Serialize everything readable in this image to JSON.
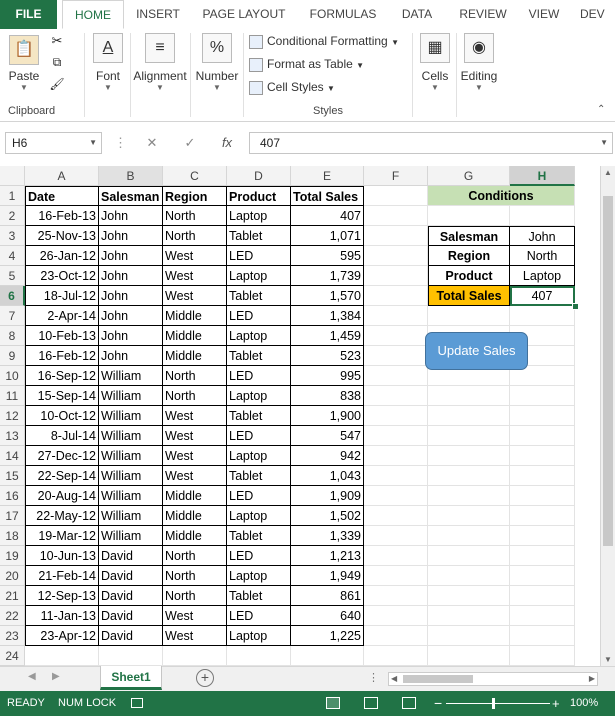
{
  "tabs": [
    "FILE",
    "HOME",
    "INSERT",
    "PAGE LAYOUT",
    "FORMULAS",
    "DATA",
    "REVIEW",
    "VIEW",
    "DEV"
  ],
  "ribbon": {
    "clipboard_label": "Clipboard",
    "paste": "Paste",
    "font": "Font",
    "alignment": "Alignment",
    "number": "Number",
    "cond_format": "Conditional Formatting",
    "format_table": "Format as Table",
    "cell_styles": "Cell Styles",
    "styles_label": "Styles",
    "cells": "Cells",
    "editing": "Editing"
  },
  "formula_bar": {
    "name_box": "H6",
    "value": "407",
    "fx": "fx"
  },
  "columns": [
    "A",
    "B",
    "C",
    "D",
    "E",
    "F",
    "G",
    "H"
  ],
  "rows": [
    "1",
    "2",
    "3",
    "4",
    "5",
    "6",
    "7",
    "8",
    "9",
    "10",
    "11",
    "12",
    "13",
    "14",
    "15",
    "16",
    "17",
    "18",
    "19",
    "20",
    "21",
    "22",
    "23",
    "24"
  ],
  "table": {
    "headers": [
      "Date",
      "Salesman",
      "Region",
      "Product",
      "Total Sales"
    ],
    "rows": [
      [
        "16-Feb-13",
        "John",
        "North",
        "Laptop",
        "407"
      ],
      [
        "25-Nov-13",
        "John",
        "North",
        "Tablet",
        "1,071"
      ],
      [
        "26-Jan-12",
        "John",
        "West",
        "LED",
        "595"
      ],
      [
        "23-Oct-12",
        "John",
        "West",
        "Laptop",
        "1,739"
      ],
      [
        "18-Jul-12",
        "John",
        "West",
        "Tablet",
        "1,570"
      ],
      [
        "2-Apr-14",
        "John",
        "Middle",
        "LED",
        "1,384"
      ],
      [
        "10-Feb-13",
        "John",
        "Middle",
        "Laptop",
        "1,459"
      ],
      [
        "16-Feb-12",
        "John",
        "Middle",
        "Tablet",
        "523"
      ],
      [
        "16-Sep-12",
        "William",
        "North",
        "LED",
        "995"
      ],
      [
        "15-Sep-14",
        "William",
        "North",
        "Laptop",
        "838"
      ],
      [
        "10-Oct-12",
        "William",
        "West",
        "Tablet",
        "1,900"
      ],
      [
        "8-Jul-14",
        "William",
        "West",
        "LED",
        "547"
      ],
      [
        "27-Dec-12",
        "William",
        "West",
        "Laptop",
        "942"
      ],
      [
        "22-Sep-14",
        "William",
        "West",
        "Tablet",
        "1,043"
      ],
      [
        "20-Aug-14",
        "William",
        "Middle",
        "LED",
        "1,909"
      ],
      [
        "22-May-12",
        "William",
        "Middle",
        "Laptop",
        "1,502"
      ],
      [
        "19-Mar-12",
        "William",
        "Middle",
        "Tablet",
        "1,339"
      ],
      [
        "10-Jun-13",
        "David",
        "North",
        "LED",
        "1,213"
      ],
      [
        "21-Feb-14",
        "David",
        "North",
        "Laptop",
        "1,949"
      ],
      [
        "12-Sep-13",
        "David",
        "North",
        "Tablet",
        "861"
      ],
      [
        "11-Jan-13",
        "David",
        "West",
        "LED",
        "640"
      ],
      [
        "23-Apr-12",
        "David",
        "West",
        "Laptop",
        "1,225"
      ]
    ]
  },
  "conditions": {
    "title": "Conditions",
    "rows": [
      [
        "Salesman",
        "John"
      ],
      [
        "Region",
        "North"
      ],
      [
        "Product",
        "Laptop"
      ],
      [
        "Total Sales",
        "407"
      ]
    ]
  },
  "update_button": "Update Sales",
  "sheet_tab": "Sheet1",
  "status": {
    "ready": "READY",
    "numlock": "NUM LOCK",
    "zoom": "100%"
  },
  "colors": {
    "excel_green": "#217346",
    "conditions_fill": "#c6e0b4",
    "total_sales_fill": "#ffc000",
    "button_fill": "#5b9bd5"
  }
}
